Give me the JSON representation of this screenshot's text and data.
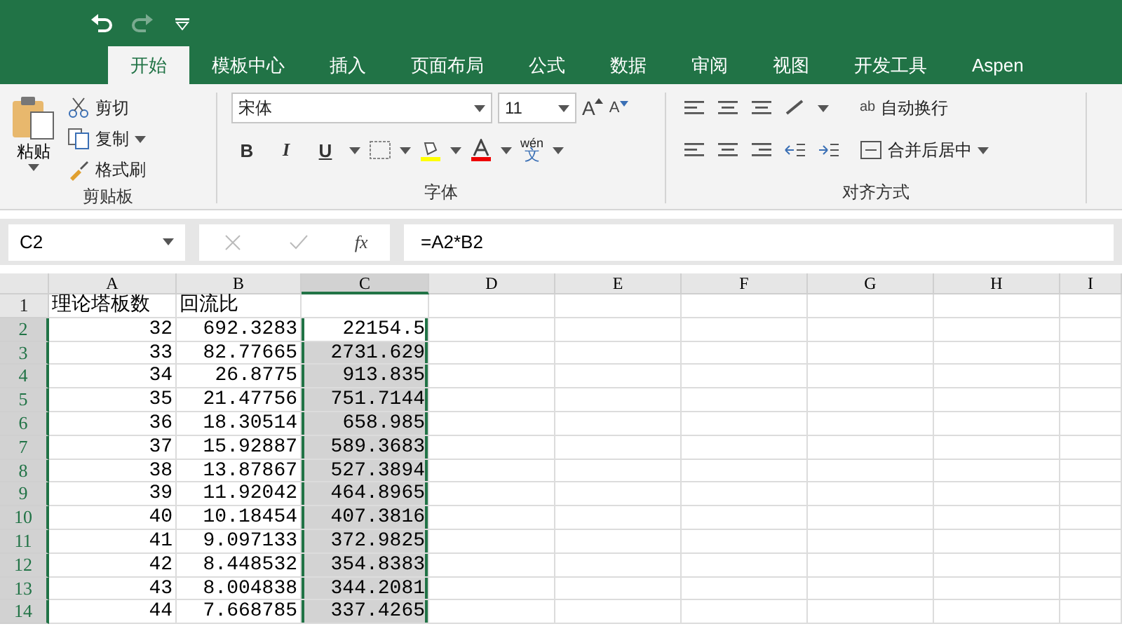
{
  "quick_access": {
    "redo_disabled": true
  },
  "tabs": [
    {
      "label": "开始",
      "selected": true
    },
    {
      "label": "模板中心",
      "selected": false
    },
    {
      "label": "插入",
      "selected": false
    },
    {
      "label": "页面布局",
      "selected": false
    },
    {
      "label": "公式",
      "selected": false
    },
    {
      "label": "数据",
      "selected": false
    },
    {
      "label": "审阅",
      "selected": false
    },
    {
      "label": "视图",
      "selected": false
    },
    {
      "label": "开发工具",
      "selected": false
    },
    {
      "label": "Aspen",
      "selected": false
    }
  ],
  "clipboard": {
    "paste": "粘贴",
    "cut": "剪切",
    "copy": "复制",
    "format_painter": "格式刷",
    "group": "剪贴板"
  },
  "font": {
    "name": "宋体",
    "size": "11",
    "grow": "A",
    "shrink": "A",
    "group": "字体",
    "bold": "B",
    "italic": "I",
    "underline": "U",
    "phonetic_top": "wén",
    "phonetic_bottom": "文"
  },
  "alignment": {
    "wrap_glyph": "ab",
    "wrap_text": "自动换行",
    "merge_center": "合并后居中",
    "group": "对齐方式"
  },
  "formula_bar": {
    "fx": "fx",
    "name_box": "C2",
    "formula": "=A2*B2"
  },
  "columns": [
    {
      "label": "A",
      "selected": false
    },
    {
      "label": "B",
      "selected": false
    },
    {
      "label": "C",
      "selected": true
    },
    {
      "label": "D",
      "selected": false
    },
    {
      "label": "E",
      "selected": false
    },
    {
      "label": "F",
      "selected": false
    },
    {
      "label": "G",
      "selected": false
    },
    {
      "label": "H",
      "selected": false
    },
    {
      "label": "I",
      "selected": false
    }
  ],
  "rows": [
    {
      "header": "1",
      "selected": false,
      "cells": [
        {
          "text": "理论塔板数",
          "selected": false
        },
        {
          "text": "回流比",
          "selected": false
        },
        {
          "text": "",
          "selected": false
        }
      ]
    },
    {
      "header": "2",
      "selected": true,
      "cells": [
        {
          "text": "32",
          "selected": false
        },
        {
          "text": "692.3283",
          "selected": false
        },
        {
          "text": "22154.5",
          "selected": false
        }
      ]
    },
    {
      "header": "3",
      "selected": true,
      "cells": [
        {
          "text": "33",
          "selected": false
        },
        {
          "text": "82.77665",
          "selected": false
        },
        {
          "text": "2731.629",
          "selected": true
        }
      ]
    },
    {
      "header": "4",
      "selected": true,
      "cells": [
        {
          "text": "34",
          "selected": false
        },
        {
          "text": "26.8775",
          "selected": false
        },
        {
          "text": "913.835",
          "selected": true
        }
      ]
    },
    {
      "header": "5",
      "selected": true,
      "cells": [
        {
          "text": "35",
          "selected": false
        },
        {
          "text": "21.47756",
          "selected": false
        },
        {
          "text": "751.7144",
          "selected": true
        }
      ]
    },
    {
      "header": "6",
      "selected": true,
      "cells": [
        {
          "text": "36",
          "selected": false
        },
        {
          "text": "18.30514",
          "selected": false
        },
        {
          "text": "658.985",
          "selected": true
        }
      ]
    },
    {
      "header": "7",
      "selected": true,
      "cells": [
        {
          "text": "37",
          "selected": false
        },
        {
          "text": "15.92887",
          "selected": false
        },
        {
          "text": "589.3683",
          "selected": true
        }
      ]
    },
    {
      "header": "8",
      "selected": true,
      "cells": [
        {
          "text": "38",
          "selected": false
        },
        {
          "text": "13.87867",
          "selected": false
        },
        {
          "text": "527.3894",
          "selected": true
        }
      ]
    },
    {
      "header": "9",
      "selected": true,
      "cells": [
        {
          "text": "39",
          "selected": false
        },
        {
          "text": "11.92042",
          "selected": false
        },
        {
          "text": "464.8965",
          "selected": true
        }
      ]
    },
    {
      "header": "10",
      "selected": true,
      "cells": [
        {
          "text": "40",
          "selected": false
        },
        {
          "text": "10.18454",
          "selected": false
        },
        {
          "text": "407.3816",
          "selected": true
        }
      ]
    },
    {
      "header": "11",
      "selected": true,
      "cells": [
        {
          "text": "41",
          "selected": false
        },
        {
          "text": "9.097133",
          "selected": false
        },
        {
          "text": "372.9825",
          "selected": true
        }
      ]
    },
    {
      "header": "12",
      "selected": true,
      "cells": [
        {
          "text": "42",
          "selected": false
        },
        {
          "text": "8.448532",
          "selected": false
        },
        {
          "text": "354.8383",
          "selected": true
        }
      ]
    },
    {
      "header": "13",
      "selected": true,
      "cells": [
        {
          "text": "43",
          "selected": false
        },
        {
          "text": "8.004838",
          "selected": false
        },
        {
          "text": "344.2081",
          "selected": true
        }
      ]
    },
    {
      "header": "14",
      "selected": true,
      "cells": [
        {
          "text": "44",
          "selected": false
        },
        {
          "text": "7.668785",
          "selected": false
        },
        {
          "text": "337.4265",
          "selected": true
        }
      ]
    }
  ]
}
